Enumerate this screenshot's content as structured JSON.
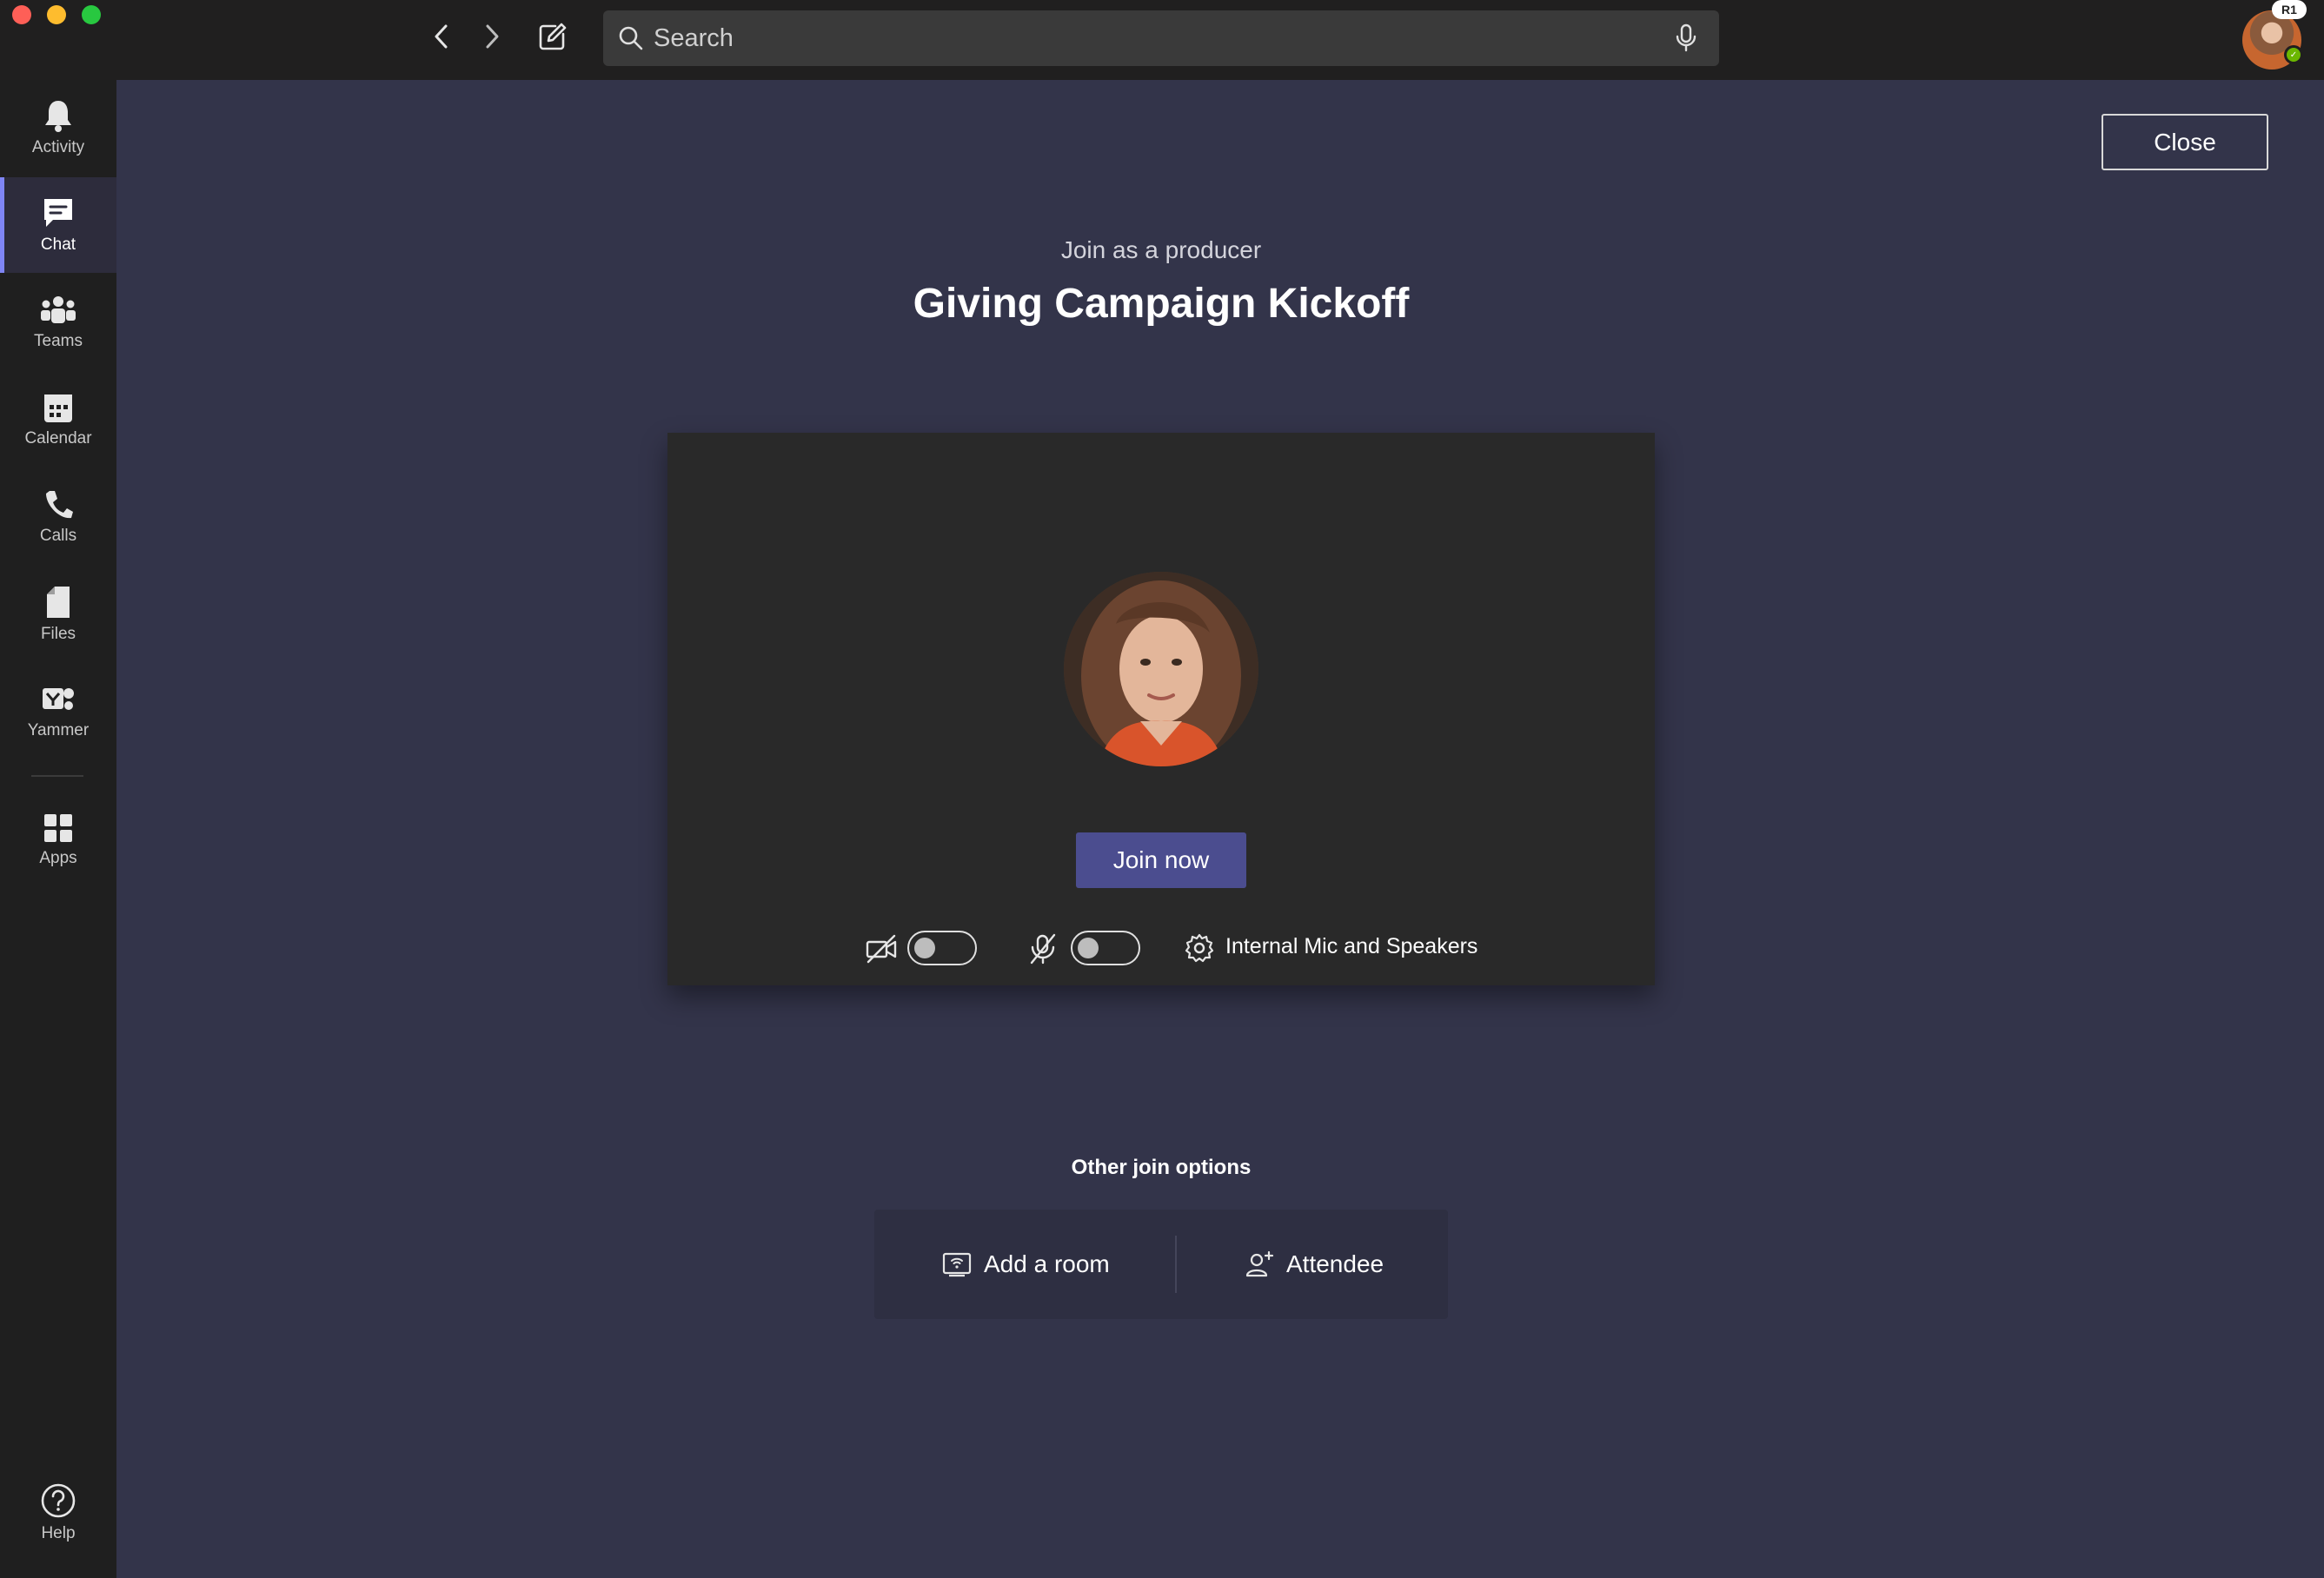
{
  "window": {
    "search_placeholder": "Search",
    "user_badge": "R1"
  },
  "rail": {
    "items": [
      {
        "label": "Activity",
        "icon": "bell-icon"
      },
      {
        "label": "Chat",
        "icon": "chat-icon",
        "active": true
      },
      {
        "label": "Teams",
        "icon": "teams-icon"
      },
      {
        "label": "Calendar",
        "icon": "calendar-icon"
      },
      {
        "label": "Calls",
        "icon": "phone-icon"
      },
      {
        "label": "Files",
        "icon": "file-icon"
      },
      {
        "label": "Yammer",
        "icon": "yammer-icon"
      },
      {
        "label": "Apps",
        "icon": "apps-icon"
      }
    ],
    "help_label": "Help"
  },
  "meeting": {
    "close_label": "Close",
    "role_text": "Join as a producer",
    "title": "Giving Campaign Kickoff",
    "join_label": "Join now",
    "camera_on": false,
    "mic_on": false,
    "device_label": "Internal Mic and Speakers"
  },
  "other_options": {
    "title": "Other join options",
    "add_room_label": "Add a room",
    "attendee_label": "Attendee"
  },
  "colors": {
    "stage": "#33344a",
    "rail": "#1f1f1f",
    "accent": "#4b4d8f",
    "active_indicator": "#7f85f5"
  }
}
